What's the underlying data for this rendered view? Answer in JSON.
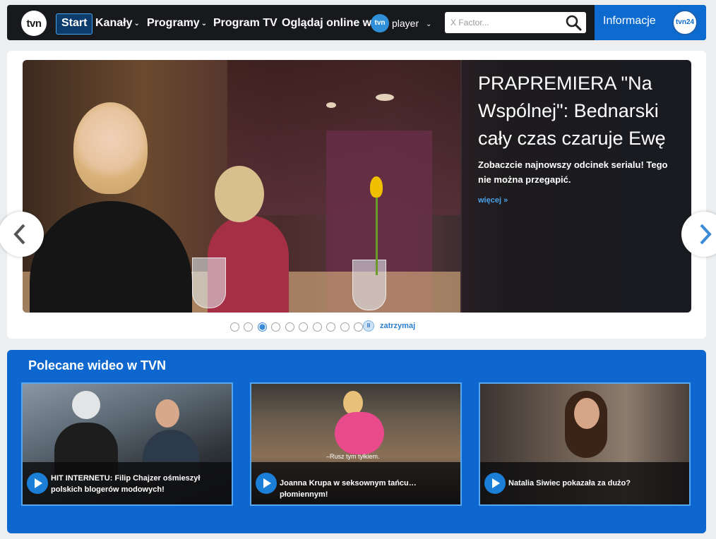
{
  "nav": {
    "logo": "tvn",
    "items": [
      {
        "label": "Start",
        "has_dropdown": false
      },
      {
        "label": "Kanały",
        "has_dropdown": true
      },
      {
        "label": "Programy",
        "has_dropdown": true
      },
      {
        "label": "Program TV",
        "has_dropdown": false
      },
      {
        "label": "Oglądaj online w",
        "has_dropdown": false
      }
    ],
    "player_badge": "tvn",
    "player_label": "player",
    "search_placeholder": "X Factor...",
    "info_label": "Informacje",
    "info_logo": "tvn24"
  },
  "hero": {
    "title": "PRAPREMIERA \"Na Wspólnej\": Bednarski cały czas czaruje Ewę",
    "description": "Zobaczcie najnowszy odcinek serialu! Tego nie można przegapić.",
    "more_link": "więcej »",
    "slides_count": 10,
    "active_slide": 3,
    "pause_label": "zatrzymaj"
  },
  "videos": {
    "section_title": "Polecane wideo w TVN",
    "items": [
      {
        "caption": "HIT INTERNETU: Filip Chajzer ośmieszył polskich blogerów modowych!"
      },
      {
        "caption": "Joanna Krupa w seksownym tańcu… płomiennym!",
        "subtitle": "–Rusz tym tyłkiem."
      },
      {
        "caption": "Natalia Siwiec pokazała za dużo?"
      }
    ]
  },
  "colors": {
    "nav_bg": "#17191c",
    "accent_blue": "#0e67cf",
    "link_blue": "#4aa3e8"
  }
}
